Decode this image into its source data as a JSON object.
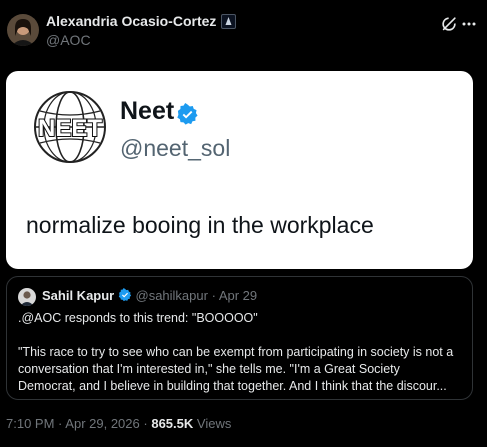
{
  "author": {
    "name": "Alexandria Ocasio-Cortez",
    "handle": "@AOC"
  },
  "image_card": {
    "logo_text": "NEET",
    "name": "Neet",
    "handle": "@neet_sol",
    "text": "normalize booing in the workplace"
  },
  "quoted_tweet": {
    "author_name": "Sahil Kapur",
    "author_handle": "@sahilkapur",
    "date": "Apr 29",
    "line1": ".@AOC responds to this trend: \"BOOOOO\"",
    "line2": "\"This race to try to see who can be exempt from participating in society is not a",
    "line3": "conversation that I'm interested in,\" she tells me. \"I'm a Great Society",
    "line4": "Democrat, and I believe in building that together. And I think that the discour..."
  },
  "footer": {
    "time": "7:10 PM",
    "date": "Apr 29, 2026",
    "views_count": "865.5K",
    "views_label": "Views"
  },
  "colors": {
    "background": "#000000",
    "text": "#e7e9ea",
    "muted": "#71767b",
    "verified": "#1d9bf0",
    "border": "#2f3336"
  },
  "icons": {
    "verified": "verified-badge-icon",
    "grok": "grok-icon",
    "more": "more-options-icon"
  }
}
